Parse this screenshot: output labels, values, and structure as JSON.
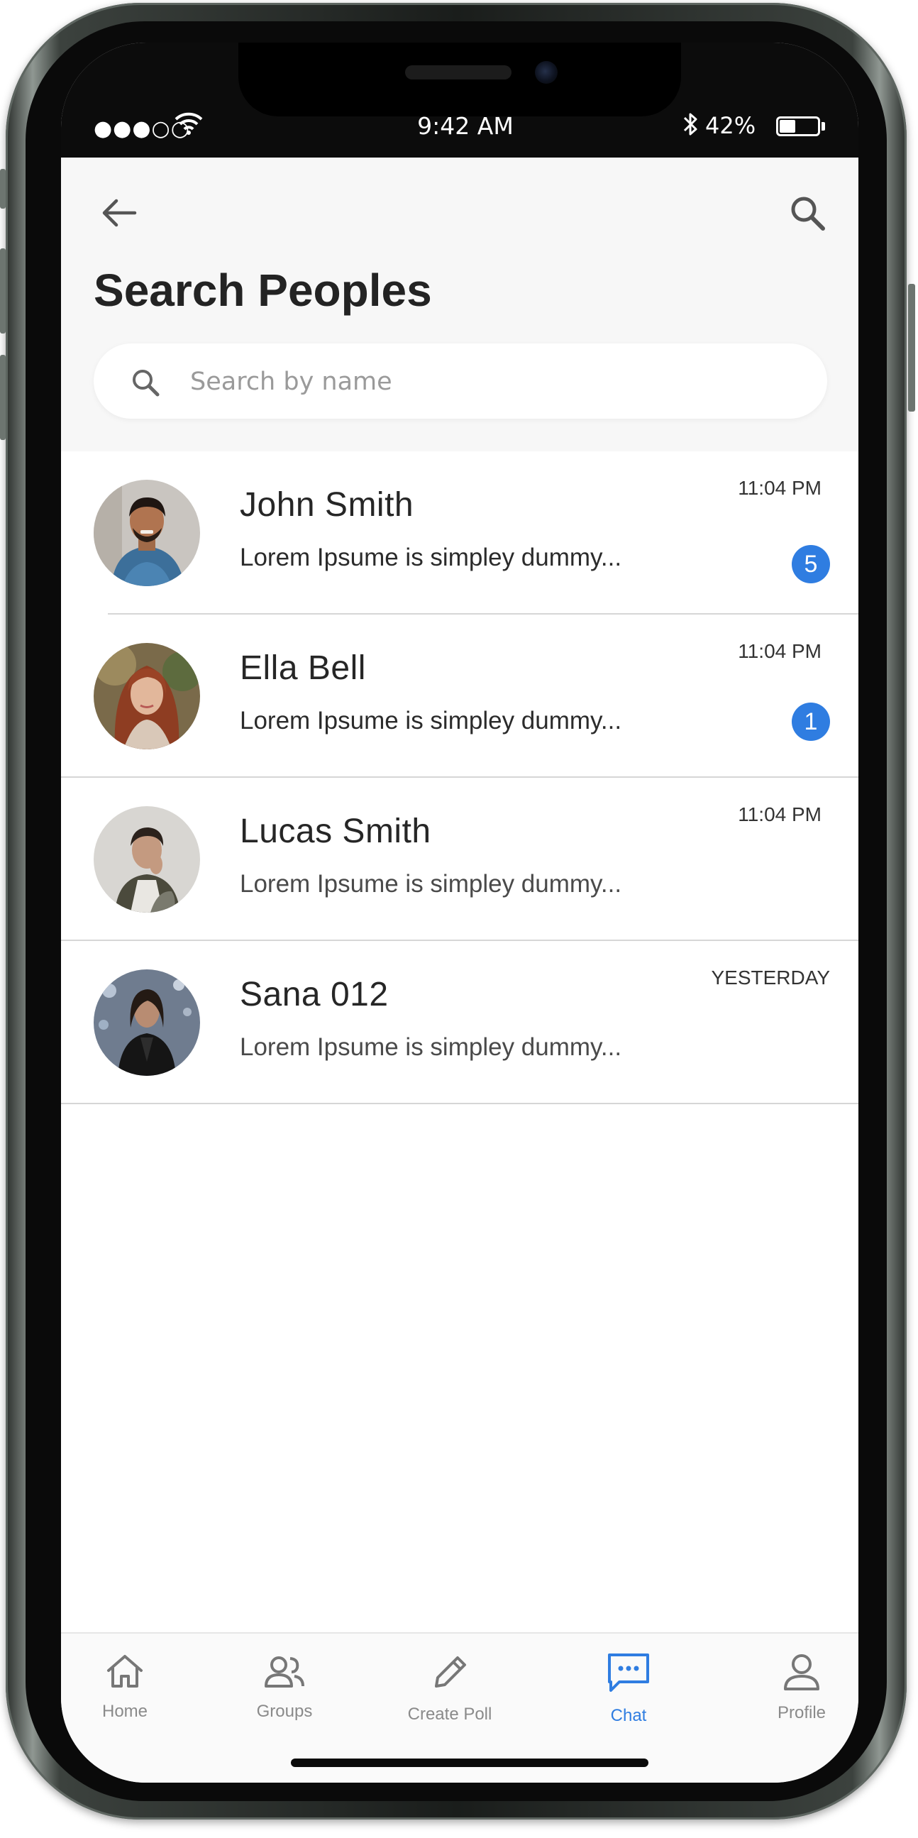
{
  "status_bar": {
    "signal": "●●●○○",
    "time": "9:42 AM",
    "battery": "42%",
    "battery_level": 0.42,
    "wifi_icon": "wifi-icon",
    "bluetooth_icon": "bluetooth-icon"
  },
  "header": {
    "back_icon": "arrow-left-icon",
    "search_icon": "search-icon",
    "title": "Search Peoples"
  },
  "search": {
    "placeholder": "Search by name",
    "icon": "search-icon"
  },
  "chats": [
    {
      "name": "John Smith",
      "preview": "Lorem Ipsume is simpley dummy...",
      "time": "11:04 PM",
      "unread": "5"
    },
    {
      "name": "Ella Bell",
      "preview": "Lorem Ipsume is simpley dummy...",
      "time": "11:04 PM",
      "unread": "1"
    },
    {
      "name": "Lucas Smith",
      "preview": "Lorem Ipsume is simpley dummy...",
      "time": "11:04 PM",
      "unread": ""
    },
    {
      "name": "Sana 012",
      "preview": "Lorem Ipsume is simpley dummy...",
      "time": "YESTERDAY",
      "unread": ""
    }
  ],
  "nav": {
    "items": [
      {
        "label": "Home",
        "icon": "home-icon"
      },
      {
        "label": "Groups",
        "icon": "groups-icon"
      },
      {
        "label": "Create Poll",
        "icon": "pencil-icon"
      },
      {
        "label": "Chat",
        "icon": "chat-icon",
        "active": true
      },
      {
        "label": "Profile",
        "icon": "profile-icon"
      }
    ]
  },
  "colors": {
    "accent": "#2f7de1",
    "badge": "#2f7de1",
    "header_bg": "#f7f7f7",
    "text": "#232323"
  }
}
